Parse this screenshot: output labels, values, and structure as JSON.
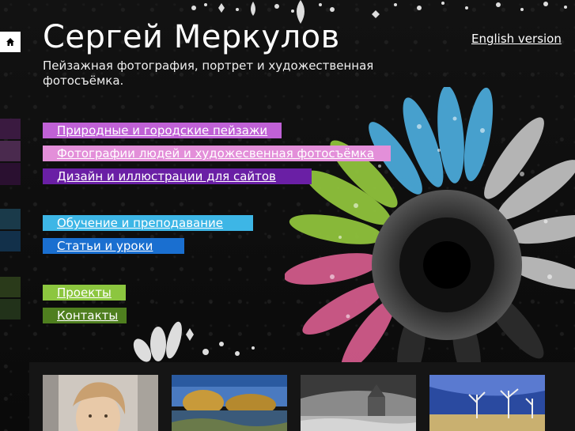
{
  "header": {
    "title": "Сергей Меркулов",
    "subtitle": "Пейзажная фотография, портрет и художественная фотосъёмка.",
    "lang_link": "English version"
  },
  "nav": [
    {
      "label": "Природные и городские пейзажи",
      "color": "#c061d6"
    },
    {
      "label": "Фотографии людей и художесвенная фотосъёмка",
      "color": "#e38fd9"
    },
    {
      "label": "Дизайн и иллюстрации для сайтов",
      "color": "#6a1fa5"
    },
    {
      "label": "Обучение и преподавание",
      "color": "#3db6e6"
    },
    {
      "label": "Статьи и уроки",
      "color": "#1a6fd0"
    },
    {
      "label": "Проекты",
      "color": "#8cc63f"
    },
    {
      "label": "Контакты",
      "color": "#4f7f1f"
    }
  ],
  "icons": {
    "home": "home-icon"
  },
  "thumbnails": [
    {
      "subject": "portrait"
    },
    {
      "subject": "autumn-river"
    },
    {
      "subject": "bw-church"
    },
    {
      "subject": "winter-trees"
    }
  ]
}
